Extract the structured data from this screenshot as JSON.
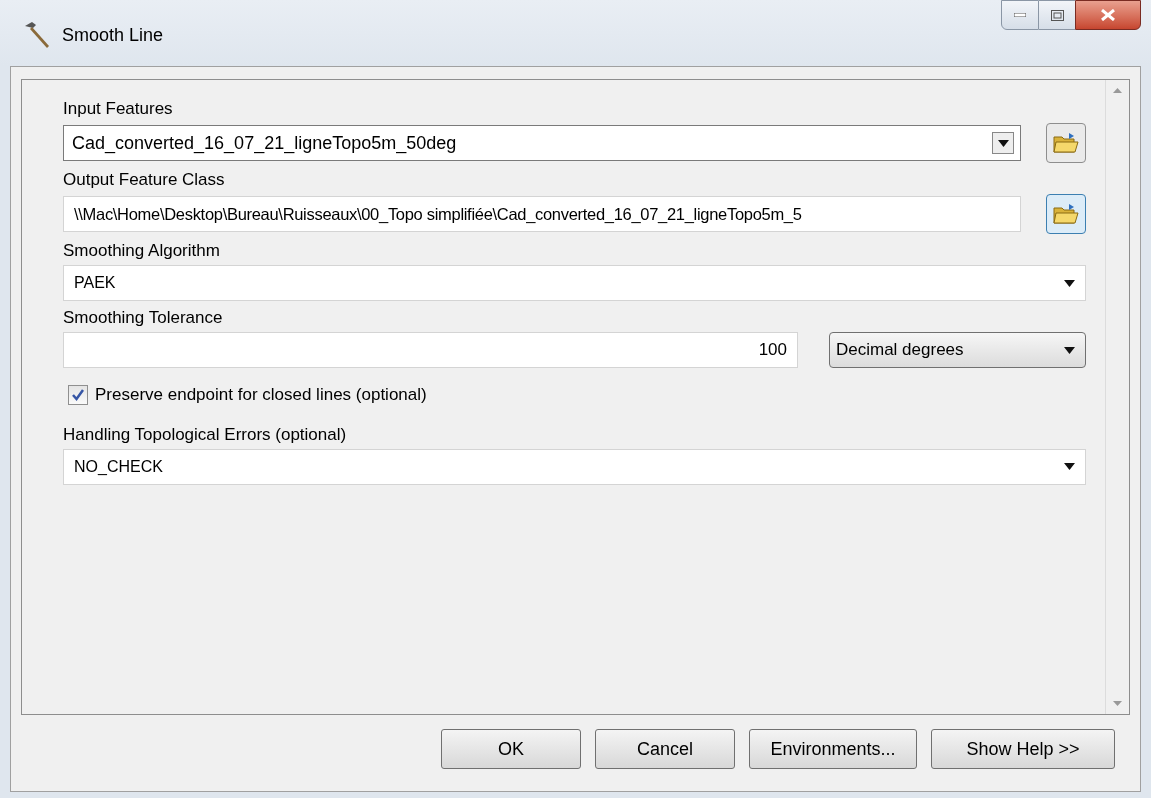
{
  "window": {
    "title": "Smooth Line"
  },
  "parameters": [
    {
      "kind": "combo",
      "label": "Input Features",
      "value": "Cad_converted_16_07_21_ligneTopo5m_50deg"
    },
    {
      "kind": "path",
      "label": "Output Feature Class",
      "value": "\\\\Mac\\Home\\Desktop\\Bureau\\Ruisseaux\\00_Topo simplifiée\\Cad_converted_16_07_21_ligneTopo5m_5"
    },
    {
      "kind": "dropdown",
      "label": "Smoothing Algorithm",
      "value": "PAEK"
    },
    {
      "kind": "number_unit",
      "label": "Smoothing Tolerance",
      "value": "100",
      "unit": "Decimal degrees"
    },
    {
      "kind": "checkbox",
      "label": "Preserve endpoint for closed lines (optional)",
      "checked": true
    },
    {
      "kind": "dropdown",
      "label": "Handling Topological Errors (optional)",
      "value": "NO_CHECK"
    }
  ],
  "buttons": [
    "OK",
    "Cancel",
    "Environments...",
    "Show Help >>"
  ]
}
